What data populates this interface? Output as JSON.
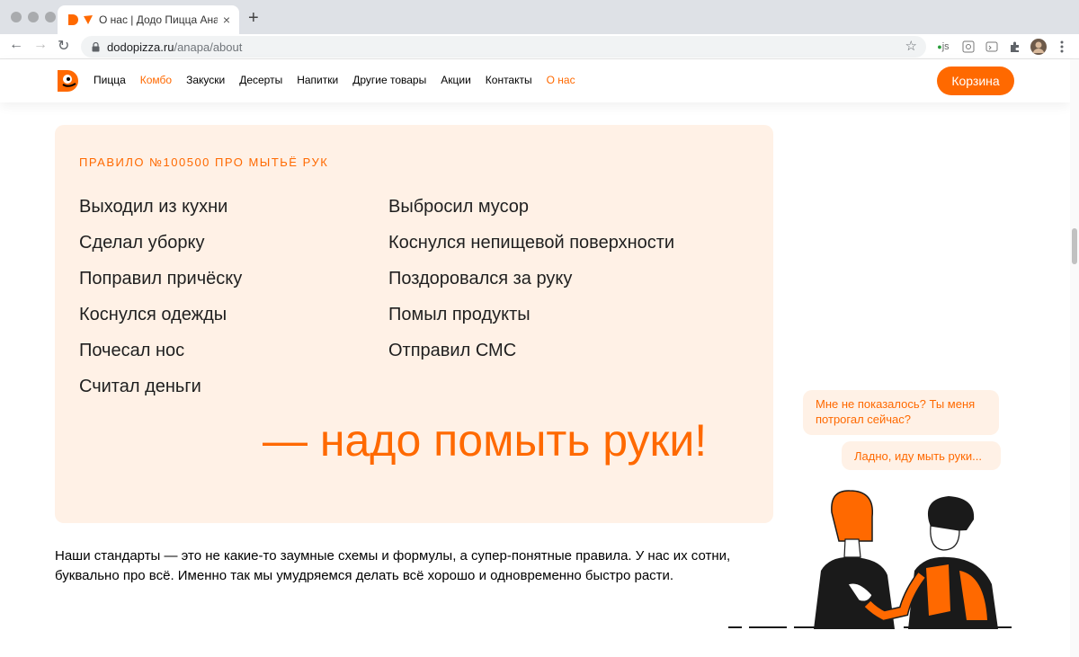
{
  "browser": {
    "tab_title": "О нас | Додо Пицца Анапа",
    "tab_close": "×",
    "new_tab": "+",
    "url_host": "dodopizza.ru",
    "url_path": "/anapa/about",
    "ext_js_label": "js"
  },
  "header": {
    "nav": [
      {
        "label": "Пицца",
        "active": false
      },
      {
        "label": "Комбо",
        "active": true
      },
      {
        "label": "Закуски",
        "active": false
      },
      {
        "label": "Десерты",
        "active": false
      },
      {
        "label": "Напитки",
        "active": false
      },
      {
        "label": "Другие товары",
        "active": false
      },
      {
        "label": "Акции",
        "active": false
      },
      {
        "label": "Контакты",
        "active": false
      },
      {
        "label": "О нас",
        "active": true
      }
    ],
    "cart_label": "Корзина"
  },
  "rule": {
    "heading": "ПРАВИЛО №100500 ПРО МЫТЬЁ РУК",
    "left_items": [
      "Выходил из кухни",
      "Сделал уборку",
      "Поправил причёску",
      "Коснулся одежды",
      "Почесал нос",
      "Считал деньги"
    ],
    "right_items": [
      "Выбросил мусор",
      "Коснулся непищевой поверхности",
      "Поздоровался за руку",
      "Помыл продукты",
      "Отправил СМС"
    ],
    "conclusion": "— надо помыть руки!"
  },
  "description": "Наши стандарты — это не какие-то заумные схемы и формулы, а супер-понятные правила. У нас их сотни, буквально про всё. Именно так мы умудряемся делать всё хорошо и одновременно быстро расти.",
  "chat": {
    "bubble1": "Мне не показалось? Ты меня потрогал сейчас?",
    "bubble2": "Ладно, иду мыть руки..."
  },
  "colors": {
    "accent": "#ff6900",
    "card_bg": "#fff1e6"
  }
}
